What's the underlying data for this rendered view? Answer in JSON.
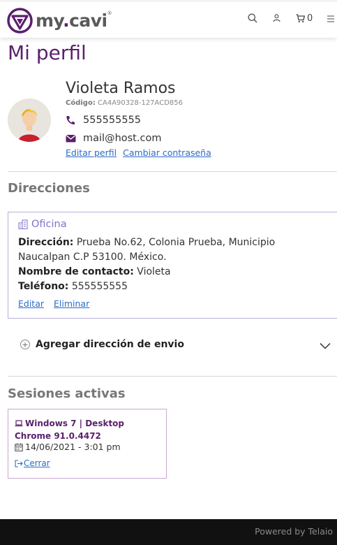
{
  "header": {
    "logo": {
      "text_main": "my",
      "text_dot": ".",
      "text_brand": "cavi",
      "trademark": "®"
    },
    "cart_count": "0"
  },
  "page": {
    "title": "Mi perfil"
  },
  "profile": {
    "name": "Violeta Ramos",
    "code_label": "Código:",
    "code_value": "CA4A90328-127ACD856",
    "phone": "555555555",
    "email": "mail@host.com",
    "edit_profile_link": "Editar perfil",
    "change_password_link": "Cambiar contraseña"
  },
  "addresses": {
    "section_title": "Direcciones",
    "items": [
      {
        "label": "Oficina",
        "address_label": "Dirección:",
        "address_line1": "Prueba No.62, Colonia Prueba, Municipio",
        "address_line2": "Naucalpan C.P 53100. México.",
        "contact_label": "Nombre de contacto:",
        "contact_value": "Violeta",
        "phone_label": "Teléfono:",
        "phone_value": "555555555",
        "edit_link": "Editar",
        "delete_link": "Eliminar"
      }
    ],
    "add_label": "Agregar dirección de envio"
  },
  "sessions": {
    "section_title": "Sesiones activas",
    "items": [
      {
        "device": "Windows 7 | Desktop Chrome 91.0.4472",
        "datetime": "14/06/2021 - 3:01 pm",
        "close_link": " Cerrar"
      }
    ]
  },
  "footer": {
    "text": "Powered by Telaio"
  },
  "colors": {
    "brand_purple": "#5a1f6e",
    "link_blue": "#2b6cc4",
    "address_accent": "#7d72c9",
    "footer_bg": "#111111"
  }
}
